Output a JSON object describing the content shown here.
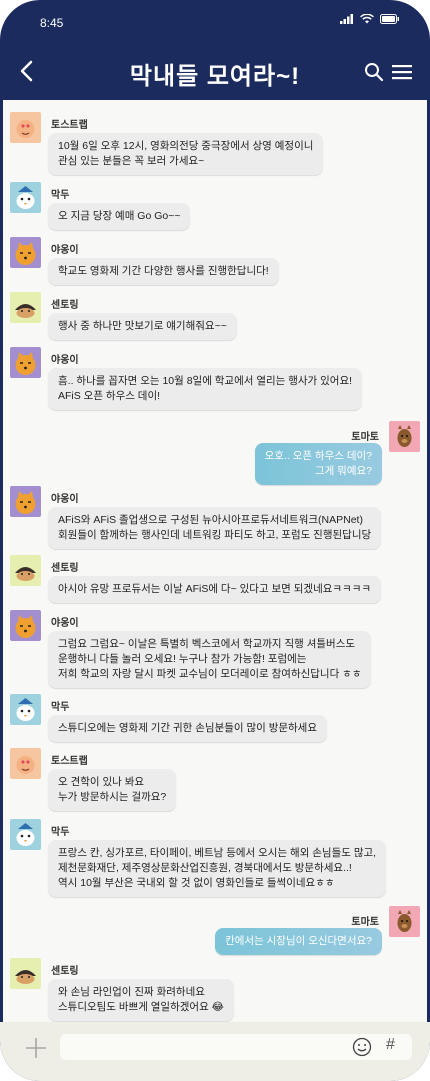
{
  "status_bar": {
    "time": "8:45"
  },
  "header": {
    "title": "막내들 모여라~!"
  },
  "colors": {
    "header_bg": "#1b2b5e",
    "chat_bg": "#f8f8f6",
    "bubble": "#ececec",
    "my_bubble": "#8dc7dc",
    "input_bar": "#eeede6"
  },
  "messages": [
    {
      "sender": "토스트랩",
      "avatar": "toast-avatar",
      "text": "10월 6일 오후 12시, 영화의전당 중극장에서 상영 예정이니\n관심 있는 분들은 꼭 보러 가세요~"
    },
    {
      "sender": "막두",
      "avatar": "makdu-avatar",
      "text": "오 지금 당장 예매 Go Go~~"
    },
    {
      "sender": "야옹이",
      "avatar": "yaong-avatar",
      "text": "학교도 영화제 기간 다양한 행사를 진행한답니다!"
    },
    {
      "sender": "센토링",
      "avatar": "sentoring-avatar",
      "text": "행사 중 하나만 맛보기로 얘기해줘요~~"
    },
    {
      "sender": "야옹이",
      "avatar": "yaong-avatar",
      "text": "흠.. 하나를 꼽자면 오는 10월 8일에 학교에서 열리는 행사가 있어요!\nAFiS 오픈 하우스 데이!"
    },
    {
      "sender": "토마토",
      "avatar": "tomato-avatar",
      "mine": true,
      "text": "오호.. 오픈 하우스 데이?\n그게 뭐예요?"
    },
    {
      "sender": "야옹이",
      "avatar": "yaong-avatar",
      "text": "AFiS와 AFiS 졸업생으로 구성된 뉴아시아프로듀서네트워크(NAPNet)\n회원들이 함께하는 행사인데 네트워킹 파티도 하고, 포럼도 진행된답니당"
    },
    {
      "sender": "센토링",
      "avatar": "sentoring-avatar",
      "text": "아시아 유망 프로듀서는 이날 AFiS에 다~ 있다고 보면 되겠네요ㅋㅋㅋㅋ"
    },
    {
      "sender": "야옹이",
      "avatar": "yaong-avatar",
      "text": "그럼요 그럼요~ 이날은 특별히 벡스코에서 학교까지 직행 셔틀버스도\n운행하니 다들 놀러 오세요! 누구나 참가 가능함! 포럼에는\n저희 학교의 자랑 달시 파켓 교수님이 모더레이로 참여하신답니다 ㅎㅎ"
    },
    {
      "sender": "막두",
      "avatar": "makdu-avatar",
      "text": "스튜디오에는 영화제 기간 귀한 손님분들이 많이 방문하세요"
    },
    {
      "sender": "토스트랩",
      "avatar": "toast-avatar",
      "text": "오 견학이 있나 봐요\n누가 방문하시는 걸까요?"
    },
    {
      "sender": "막두",
      "avatar": "makdu-avatar",
      "text": "프랑스 칸, 싱가포르, 타이페이, 베트남 등에서 오시는 해외 손님들도 많고,\n제천문화재단, 제주영상문화산업진흥원, 경북대에서도 방문하세요..!\n역시 10월 부산은 국내외 할 것 없이 영화인들로 들썩이네요ㅎㅎ"
    },
    {
      "sender": "토마토",
      "avatar": "tomato-avatar",
      "mine": true,
      "text": "칸에서는 시장님이 오신다면서요?"
    },
    {
      "sender": "센토링",
      "avatar": "sentoring-avatar",
      "text": "와 손님 라인업이 진짜 화려하네요\n스튜디오팀도 바쁘게 열일하겠어요 😂"
    }
  ],
  "input": {
    "placeholder": "",
    "hash_label": "#"
  }
}
